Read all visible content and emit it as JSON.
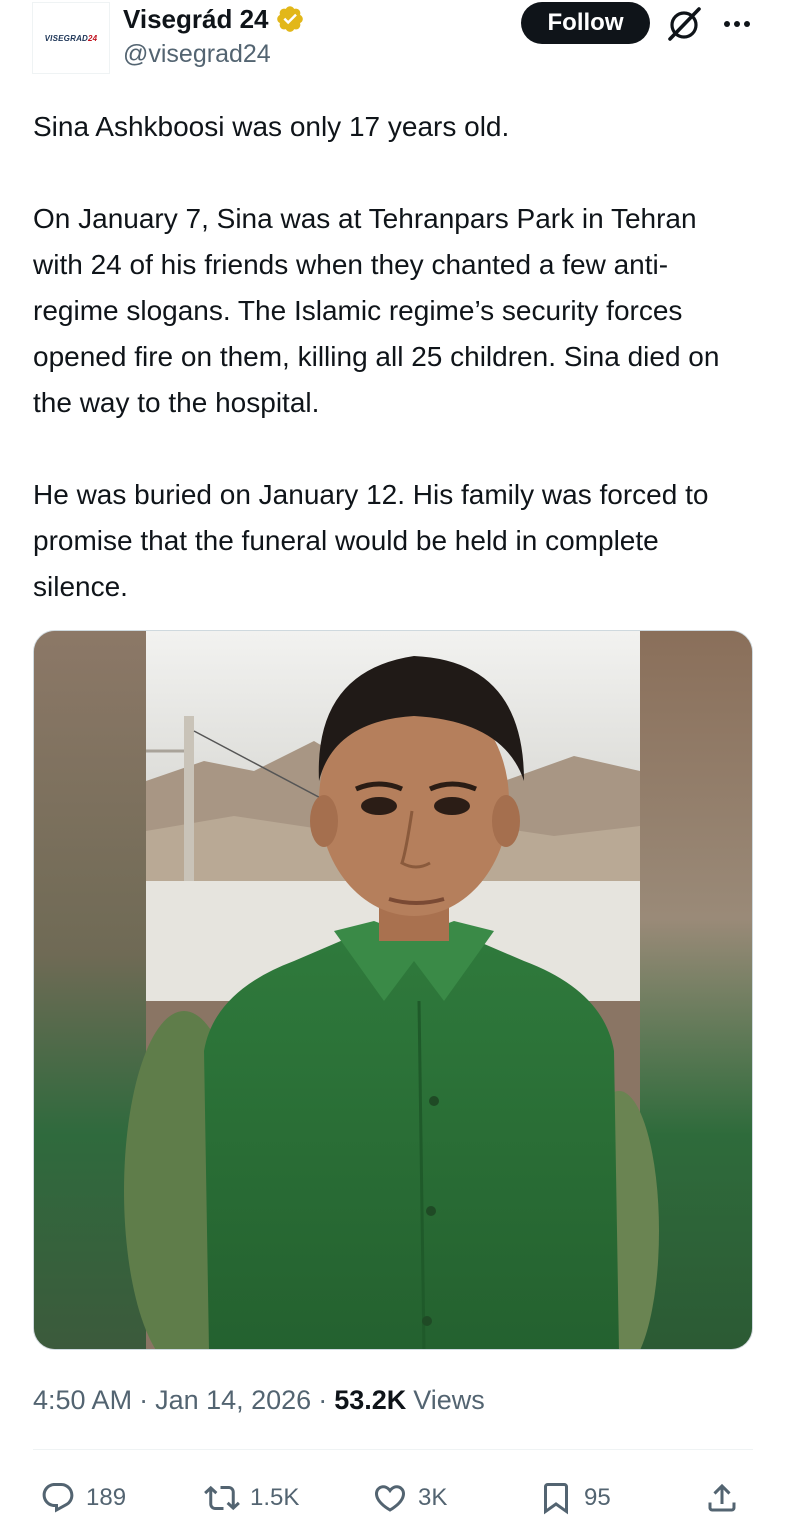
{
  "author": {
    "avatar_text": "VISEGRAD",
    "avatar_accent": "24",
    "display_name": "Visegrád 24",
    "handle": "@visegrad24",
    "verified_icon": "verified-badge-icon",
    "verified_color": "#e2b719"
  },
  "header": {
    "follow_label": "Follow",
    "grok_icon": "grok-icon",
    "more_icon": "more-icon"
  },
  "tweet": {
    "paragraphs": [
      "Sina Ashkboosi was only 17 years old.",
      "On January 7, Sina was at Tehranpars Park in Tehran with 24 of his friends when they chanted a few anti-regime slogans. The Islamic regime’s security forces opened fire on them, killing all 25 children. Sina died on the way to the hospital.",
      "He was buried on January 12. His family was forced to promise that the funeral would be held in complete silence."
    ]
  },
  "meta": {
    "time": "4:50 AM",
    "date": "Jan 14, 2026",
    "views_count": "53.2K",
    "views_label": "Views"
  },
  "actions": {
    "replies": {
      "icon": "reply-icon",
      "count": "189"
    },
    "reposts": {
      "icon": "repost-icon",
      "count": "1.5K"
    },
    "likes": {
      "icon": "like-icon",
      "count": "3K"
    },
    "bookmarks": {
      "icon": "bookmark-icon",
      "count": "95"
    },
    "share": {
      "icon": "share-icon"
    }
  },
  "colors": {
    "text": "#0f1419",
    "secondary": "#536471",
    "button_bg": "#0f1419",
    "shirt_green": "#2f7a3c"
  }
}
